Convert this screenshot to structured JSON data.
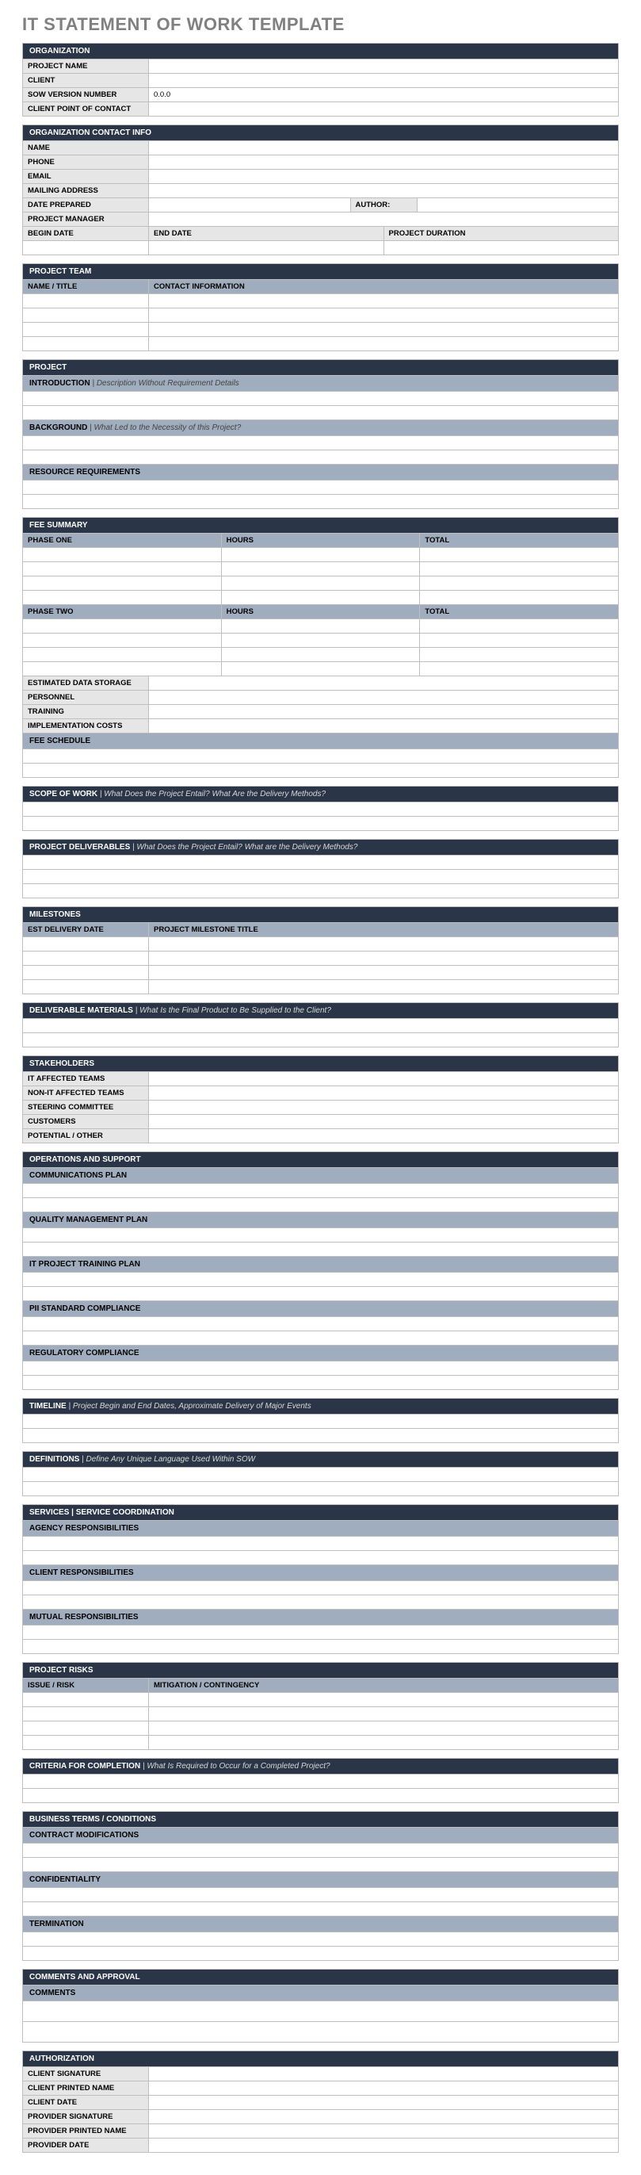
{
  "title": "IT STATEMENT OF WORK TEMPLATE",
  "org": {
    "hdr": "ORGANIZATION",
    "project_name_lbl": "PROJECT NAME",
    "client_lbl": "CLIENT",
    "sow_ver_lbl": "SOW VERSION NUMBER",
    "sow_ver_val": "0.0.0",
    "poc_lbl": "CLIENT POINT OF CONTACT"
  },
  "contact": {
    "hdr": "ORGANIZATION CONTACT INFO",
    "name_lbl": "NAME",
    "phone_lbl": "PHONE",
    "email_lbl": "EMAIL",
    "mail_lbl": "MAILING ADDRESS",
    "date_prep_lbl": "DATE PREPARED",
    "author_lbl": "AUTHOR:",
    "pm_lbl": "PROJECT MANAGER",
    "begin_lbl": "BEGIN DATE",
    "end_lbl": "END DATE",
    "dur_lbl": "PROJECT DURATION"
  },
  "team": {
    "hdr": "PROJECT TEAM",
    "col1": "NAME / TITLE",
    "col2": "CONTACT INFORMATION"
  },
  "project": {
    "hdr": "PROJECT",
    "intro_lbl": "INTRODUCTION",
    "intro_hint": " |  Description Without Requirement Details",
    "bg_lbl": "BACKGROUND",
    "bg_hint": " |  What Led to the Necessity of this Project?",
    "res_lbl": "RESOURCE REQUIREMENTS"
  },
  "fee": {
    "hdr": "FEE SUMMARY",
    "p1": "PHASE ONE",
    "p2": "PHASE TWO",
    "hours": "HOURS",
    "total": "TOTAL",
    "storage": "ESTIMATED DATA STORAGE",
    "personnel": "PERSONNEL",
    "training": "TRAINING",
    "impl": "IMPLEMENTATION COSTS",
    "sched": "FEE SCHEDULE"
  },
  "scope": {
    "hdr": "SCOPE OF WORK ",
    "hint": " |  What Does the Project Entail? What Are the Delivery Methods?"
  },
  "deliv": {
    "hdr": "PROJECT DELIVERABLES ",
    "hint": " |  What Does the Project Entail? What are the Delivery Methods?"
  },
  "milestones": {
    "hdr": "MILESTONES",
    "col1": "EST DELIVERY DATE",
    "col2": "PROJECT MILESTONE TITLE"
  },
  "dmat": {
    "hdr": "DELIVERABLE MATERIALS ",
    "hint": " |  What Is the Final Product to Be Supplied to the Client?"
  },
  "stake": {
    "hdr": "STAKEHOLDERS",
    "it": "IT AFFECTED TEAMS",
    "nonit": "NON-IT AFFECTED TEAMS",
    "steer": "STEERING COMMITTEE",
    "cust": "CUSTOMERS",
    "pot": "POTENTIAL / OTHER"
  },
  "ops": {
    "hdr": "OPERATIONS AND SUPPORT",
    "comm": "COMMUNICATIONS PLAN",
    "qm": "QUALITY MANAGEMENT PLAN",
    "train": "IT PROJECT TRAINING PLAN",
    "pii": "PII STANDARD COMPLIANCE",
    "reg": "REGULATORY COMPLIANCE"
  },
  "timeline": {
    "hdr": "TIMELINE ",
    "hint": " |  Project Begin and End Dates, Approximate Delivery of Major Events"
  },
  "defs": {
    "hdr": "DEFINITIONS ",
    "hint": " |  Define Any Unique Language Used Within SOW"
  },
  "services": {
    "hdr": "SERVICES | SERVICE COORDINATION",
    "agency": "AGENCY RESPONSIBILITIES",
    "client": "CLIENT RESPONSIBILITIES",
    "mutual": "MUTUAL RESPONSIBILITIES"
  },
  "risks": {
    "hdr": "PROJECT RISKS",
    "col1": "ISSUE / RISK",
    "col2": "MITIGATION / CONTINGENCY"
  },
  "criteria": {
    "hdr": "CRITERIA FOR COMPLETION ",
    "hint": " |  What Is Required to Occur for a Completed Project?"
  },
  "terms": {
    "hdr": "BUSINESS TERMS / CONDITIONS",
    "mods": "CONTRACT MODIFICATIONS",
    "conf": "CONFIDENTIALITY",
    "term": "TERMINATION"
  },
  "comments": {
    "hdr": "COMMENTS AND APPROVAL",
    "lbl": "COMMENTS"
  },
  "auth": {
    "hdr": "AUTHORIZATION",
    "csig": "CLIENT SIGNATURE",
    "cname": "CLIENT PRINTED NAME",
    "cdate": "CLIENT DATE",
    "psig": "PROVIDER SIGNATURE",
    "pname": "PROVIDER PRINTED NAME",
    "pdate": "PROVIDER DATE"
  }
}
